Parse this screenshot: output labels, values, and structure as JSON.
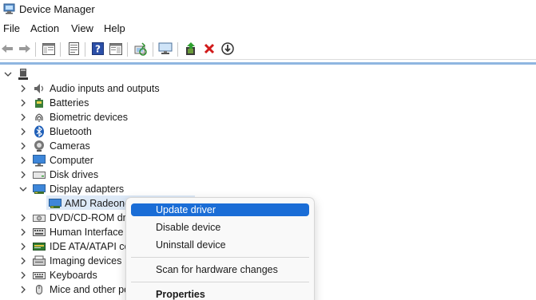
{
  "window": {
    "title": "Device Manager"
  },
  "menubar": {
    "items": [
      "File",
      "Action",
      "View",
      "Help"
    ]
  },
  "toolbar": {
    "icons": [
      "back-arrow-icon",
      "forward-arrow-icon",
      "show-hide-console-tree-icon",
      "properties-sheet-icon",
      "help-icon",
      "action-pane-icon",
      "scan-hardware-icon",
      "monitor-icon",
      "update-driver-icon",
      "uninstall-x-icon",
      "download-arrow-icon"
    ]
  },
  "tree": {
    "items": [
      {
        "label": "Audio inputs and outputs",
        "icon": "speaker-icon",
        "expanded": false
      },
      {
        "label": "Batteries",
        "icon": "battery-icon",
        "expanded": false
      },
      {
        "label": "Biometric devices",
        "icon": "fingerprint-icon",
        "expanded": false
      },
      {
        "label": "Bluetooth",
        "icon": "bluetooth-icon",
        "expanded": false
      },
      {
        "label": "Cameras",
        "icon": "camera-icon",
        "expanded": false
      },
      {
        "label": "Computer",
        "icon": "computer-icon",
        "expanded": false
      },
      {
        "label": "Disk drives",
        "icon": "disk-drive-icon",
        "expanded": false
      },
      {
        "label": "Display adapters",
        "icon": "display-adapter-icon",
        "expanded": true
      },
      {
        "label": "AMD Radeon(",
        "icon": "display-adapter-icon",
        "child": true,
        "selected": true
      },
      {
        "label": "DVD/CD-ROM driv",
        "icon": "dvd-drive-icon",
        "expanded": false
      },
      {
        "label": "Human Interface D",
        "icon": "hid-icon",
        "expanded": false
      },
      {
        "label": "IDE ATA/ATAPI cor",
        "icon": "ide-controller-icon",
        "expanded": false
      },
      {
        "label": "Imaging devices",
        "icon": "imaging-icon",
        "expanded": false
      },
      {
        "label": "Keyboards",
        "icon": "keyboard-icon",
        "expanded": false
      },
      {
        "label": "Mice and other po",
        "icon": "mouse-icon",
        "expanded": false
      }
    ]
  },
  "context_menu": {
    "items": [
      {
        "label": "Update driver",
        "highlighted": true
      },
      {
        "label": "Disable device"
      },
      {
        "label": "Uninstall device"
      },
      {
        "label": "Scan for hardware changes"
      },
      {
        "label": "Properties",
        "bold": true
      }
    ]
  },
  "colors": {
    "highlight": "#1a6dd6",
    "selection": "#dde9f7",
    "toolbar_line": "#8fb6e0"
  }
}
